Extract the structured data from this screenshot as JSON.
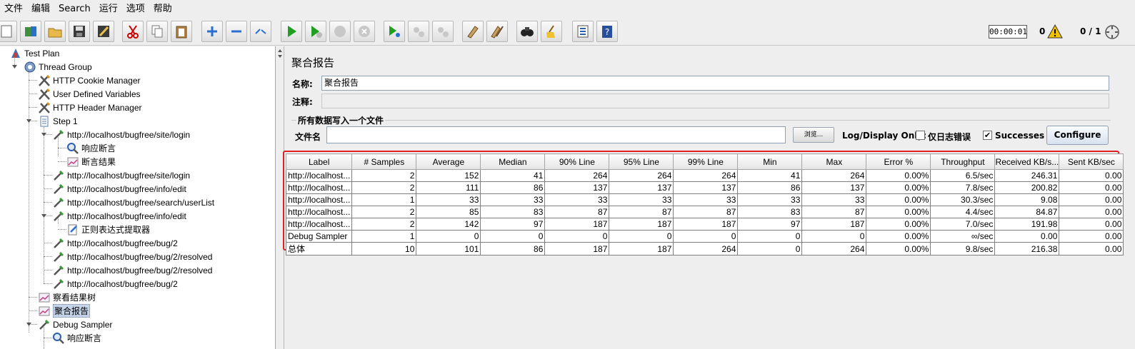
{
  "menu": [
    "文件",
    "编辑",
    "Search",
    "运行",
    "选项",
    "帮助"
  ],
  "toolbar": {
    "timer": "00:00:01",
    "error_count": "0",
    "threads": "0 / 1",
    "icons": [
      "new-icon",
      "templates-icon",
      "open-icon",
      "save-icon",
      "save-as-icon",
      "cut-icon",
      "copy-icon",
      "paste-icon",
      "expand-icon",
      "collapse-icon",
      "toggle-icon",
      "start-icon",
      "start-no-pauses-icon",
      "stop-icon",
      "shutdown-icon",
      "remote-start-icon",
      "remote-stop-icon",
      "remote-shutdown-icon",
      "clear-icon",
      "clear-all-icon",
      "search-icon",
      "reset-search-icon",
      "function-helper-icon",
      "help-icon"
    ]
  },
  "tree": {
    "items": [
      {
        "label": "Test Plan",
        "icon": "test-plan-icon"
      },
      {
        "label": "Thread Group",
        "icon": "thread-group-icon"
      },
      {
        "label": "HTTP Cookie Manager",
        "icon": "config-icon"
      },
      {
        "label": "User Defined Variables",
        "icon": "config-icon"
      },
      {
        "label": "HTTP Header Manager",
        "icon": "config-icon"
      },
      {
        "label": "Step 1",
        "icon": "controller-icon"
      },
      {
        "label": "http://localhost/bugfree/site/login",
        "icon": "sampler-icon"
      },
      {
        "label": "响应断言",
        "icon": "assertion-icon"
      },
      {
        "label": "断言结果",
        "icon": "listener-icon"
      },
      {
        "label": "http://localhost/bugfree/site/login",
        "icon": "sampler-icon"
      },
      {
        "label": "http://localhost/bugfree/info/edit",
        "icon": "sampler-icon"
      },
      {
        "label": "http://localhost/bugfree/search/userList",
        "icon": "sampler-icon"
      },
      {
        "label": "http://localhost/bugfree/info/edit",
        "icon": "sampler-icon"
      },
      {
        "label": "正则表达式提取器",
        "icon": "extractor-icon"
      },
      {
        "label": "http://localhost/bugfree/bug/2",
        "icon": "sampler-icon"
      },
      {
        "label": "http://localhost/bugfree/bug/2/resolved",
        "icon": "sampler-icon"
      },
      {
        "label": "http://localhost/bugfree/bug/2/resolved",
        "icon": "sampler-icon"
      },
      {
        "label": "http://localhost/bugfree/bug/2",
        "icon": "sampler-icon"
      },
      {
        "label": "察看结果树",
        "icon": "listener-icon"
      },
      {
        "label": "聚合报告",
        "icon": "listener-icon"
      },
      {
        "label": "Debug Sampler",
        "icon": "sampler-icon"
      },
      {
        "label": "响应断言",
        "icon": "assertion-icon"
      }
    ]
  },
  "panel": {
    "title": "聚合报告",
    "name_label": "名称:",
    "name_value": "聚合报告",
    "comment_label": "注释:",
    "comment_value": "",
    "file_group_title": "所有数据写入一个文件",
    "filename_label": "文件名",
    "filename_value": "",
    "browse_label": "浏览...",
    "log_display_label": "Log/Display Only:",
    "errors_only_label": "仅日志错误",
    "errors_only_checked": false,
    "successes_label": "Successes",
    "successes_checked": true,
    "configure_label": "Configure"
  },
  "table": {
    "headers": [
      "Label",
      "# Samples",
      "Average",
      "Median",
      "90% Line",
      "95% Line",
      "99% Line",
      "Min",
      "Max",
      "Error %",
      "Throughput",
      "Received KB/s...",
      "Sent KB/sec"
    ],
    "rows": [
      [
        "http://localhost...",
        "2",
        "152",
        "41",
        "264",
        "264",
        "264",
        "41",
        "264",
        "0.00%",
        "6.5/sec",
        "246.31",
        "0.00"
      ],
      [
        "http://localhost...",
        "2",
        "111",
        "86",
        "137",
        "137",
        "137",
        "86",
        "137",
        "0.00%",
        "7.8/sec",
        "200.82",
        "0.00"
      ],
      [
        "http://localhost...",
        "1",
        "33",
        "33",
        "33",
        "33",
        "33",
        "33",
        "33",
        "0.00%",
        "30.3/sec",
        "9.08",
        "0.00"
      ],
      [
        "http://localhost...",
        "2",
        "85",
        "83",
        "87",
        "87",
        "87",
        "83",
        "87",
        "0.00%",
        "4.4/sec",
        "84.87",
        "0.00"
      ],
      [
        "http://localhost...",
        "2",
        "142",
        "97",
        "187",
        "187",
        "187",
        "97",
        "187",
        "0.00%",
        "7.0/sec",
        "191.98",
        "0.00"
      ],
      [
        "Debug Sampler",
        "1",
        "0",
        "0",
        "0",
        "0",
        "0",
        "0",
        "0",
        "0.00%",
        "∞/sec",
        "0.00",
        "0.00"
      ],
      [
        "总体",
        "10",
        "101",
        "86",
        "187",
        "187",
        "264",
        "0",
        "264",
        "0.00%",
        "9.8/sec",
        "216.38",
        "0.00"
      ]
    ]
  },
  "colors": {
    "highlight_border": "#e02020",
    "selection": "#c6d4ea",
    "warning": "#f2c200",
    "run": "#1f9e1f"
  }
}
